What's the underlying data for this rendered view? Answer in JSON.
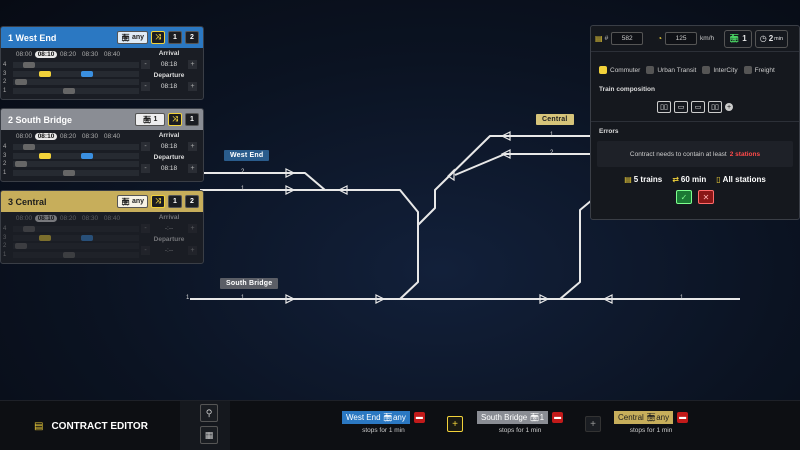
{
  "map": {
    "signs": {
      "west_end": "West End",
      "south_bridge": "South Bridge",
      "central": "Central"
    },
    "track_numbers": {
      "we_1": "1",
      "we_2": "2",
      "c_1": "1",
      "c_2": "2",
      "sb_left": "1",
      "sb_1": "1",
      "sb_right": "1"
    }
  },
  "stations": [
    {
      "number": "1",
      "name": "West End",
      "train_tag": "any",
      "count": "2",
      "times": [
        "08:00",
        "08:10",
        "08:20",
        "08:30",
        "08:40"
      ],
      "rows": [
        "4",
        "3",
        "2",
        "1"
      ],
      "arrival_label": "Arrival",
      "arrival_value": "08:18",
      "departure_label": "Departure",
      "departure_value": "08:18"
    },
    {
      "number": "2",
      "name": "South Bridge",
      "train_tag": "1",
      "count": "1",
      "times": [
        "08:00",
        "08:10",
        "08:20",
        "08:30",
        "08:40"
      ],
      "rows": [
        "4",
        "3",
        "2",
        "1"
      ],
      "arrival_label": "Arrival",
      "arrival_value": "08:18",
      "departure_label": "Departure",
      "departure_value": "08:18"
    },
    {
      "number": "3",
      "name": "Central",
      "train_tag": "any",
      "count": "2",
      "times": [
        "08:00",
        "08:10",
        "08:20",
        "08:30",
        "08:40"
      ],
      "rows": [
        "4",
        "3",
        "2",
        "1"
      ],
      "arrival_label": "Arrival",
      "arrival_value": "-:--",
      "departure_label": "Departure",
      "departure_value": "-:--"
    }
  ],
  "stepper": {
    "minus": "-",
    "plus": "+"
  },
  "contract": {
    "number_label": "#",
    "number_value": "582",
    "speed_value": "125",
    "speed_unit": "km/h",
    "trains_value": "1",
    "duration_value": "2",
    "duration_unit": "min",
    "categories": [
      {
        "label": "Commuter",
        "checked": true
      },
      {
        "label": "Urban Transit",
        "checked": false
      },
      {
        "label": "InterCity",
        "checked": false
      },
      {
        "label": "Freight",
        "checked": false
      }
    ],
    "composition_title": "Train composition",
    "errors_title": "Errors",
    "error_text": "Contract needs to contain at least",
    "error_highlight": "2 stations",
    "summary_trains": "5 trains",
    "summary_time": "60 min",
    "summary_stations": "All stations",
    "confirm_icon": "✓",
    "cancel_icon": "✕"
  },
  "bottom": {
    "editor_title": "CONTRACT EDITOR",
    "stops": [
      {
        "name": "West End",
        "tag": "any",
        "sub": "stops for 1 min",
        "color": "#2b78c2"
      },
      {
        "name": "South Bridge",
        "tag": "1",
        "sub": "stops for 1 min",
        "color": "#8a8d94"
      },
      {
        "name": "Central",
        "tag": "any",
        "sub": "stops for 1 min",
        "color": "#c7ae5b"
      }
    ],
    "plus": "+"
  },
  "colors": {
    "accent": "#f2d23a",
    "west_end": "#2b78c2",
    "south_bridge": "#8a8d94",
    "central": "#c7ae5b",
    "error": "#ff4a4a"
  }
}
